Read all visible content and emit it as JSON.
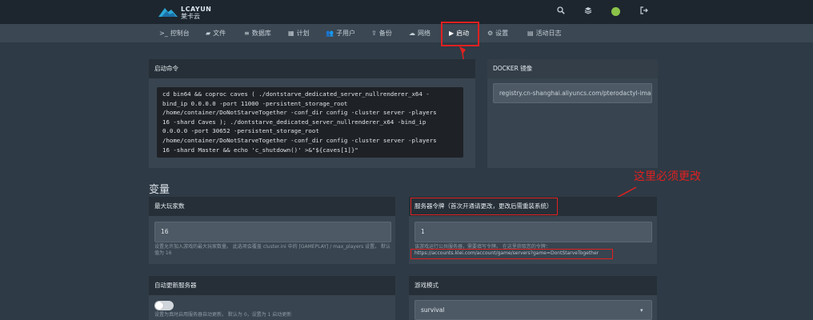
{
  "topbar": {
    "logo_text": "LCAYUN",
    "logo_cn": "莱卡云",
    "icons": [
      "search-icon",
      "layers-icon",
      "user-avatar",
      "logout-icon"
    ]
  },
  "nav": {
    "items": [
      {
        "icon": "terminal-icon",
        "glyph": ">_",
        "label": "控制台"
      },
      {
        "icon": "folder-icon",
        "glyph": "▰",
        "label": "文件"
      },
      {
        "icon": "database-icon",
        "glyph": "≡",
        "label": "数据库"
      },
      {
        "icon": "calendar-icon",
        "glyph": "▦",
        "label": "计划"
      },
      {
        "icon": "users-icon",
        "glyph": "👥",
        "label": "子用户"
      },
      {
        "icon": "upload-icon",
        "glyph": "⇪",
        "label": "备份"
      },
      {
        "icon": "network-icon",
        "glyph": "☁",
        "label": "网络"
      },
      {
        "icon": "play-icon",
        "glyph": "▶",
        "label": "启动"
      },
      {
        "icon": "cogs-icon",
        "glyph": "⚙",
        "label": "设置"
      },
      {
        "icon": "log-icon",
        "glyph": "▤",
        "label": "活动日志"
      }
    ],
    "active_index": 7
  },
  "startup": {
    "title": "启动命令",
    "command_lines": [
      "cd bin64 && coproc caves ( ./dontstarve_dedicated_server_nullrenderer_x64 -",
      "bind_ip 0.0.0.0 -port 11000 -persistent_storage_root",
      "/home/container/DoNotStarveTogether -conf_dir config -cluster server -players",
      "16 -shard Caves ); ./dontstarve_dedicated_server_nullrenderer_x64 -bind_ip",
      "0.0.0.0 -port 30652 -persistent_storage_root",
      "/home/container/DoNotStarveTogether -conf_dir config -cluster server -players",
      "16 -shard Master && echo 'c_shutdown()' >&\"${caves[1]}\""
    ]
  },
  "docker": {
    "title": "DOCKER 镜像",
    "value": "registry.cn-shanghai.aliyuncs.com/pterodactyl-image"
  },
  "variables_title": "变量",
  "annotation": "这里必须更改",
  "variables": {
    "max_players": {
      "title": "最大玩家数",
      "value": "16",
      "help": "设置允许加入游戏的最大玩家数量。 此选项会覆盖 cluster.ini 中的 [GAMEPLAY] / max_players 设置。 默认值为 16"
    },
    "server_token": {
      "title": "服务器令牌（首次开通请更改，更改后需重装系统）",
      "value": "1",
      "help": "该游戏运行公共服务器，需要填写令牌。 在这里获取您的令牌：",
      "link": "https://accounts.klei.com/account/game/servers?game=DontStarveTogether"
    },
    "auto_update": {
      "title": "自动更新服务器",
      "help": "设置为真时启用服务器自动更新。 默认为 0，设置为 1 启动更新",
      "enabled": false
    },
    "game_mode": {
      "title": "游戏模式",
      "value": "survival"
    }
  },
  "colors": {
    "page_bg": "#2e3a45",
    "topbar_bg": "#1d262e",
    "navbar_bg": "#3b4753",
    "panel_bg": "#38444f",
    "panel_head_bg": "#262f37",
    "annotation_red": "#e02020"
  }
}
